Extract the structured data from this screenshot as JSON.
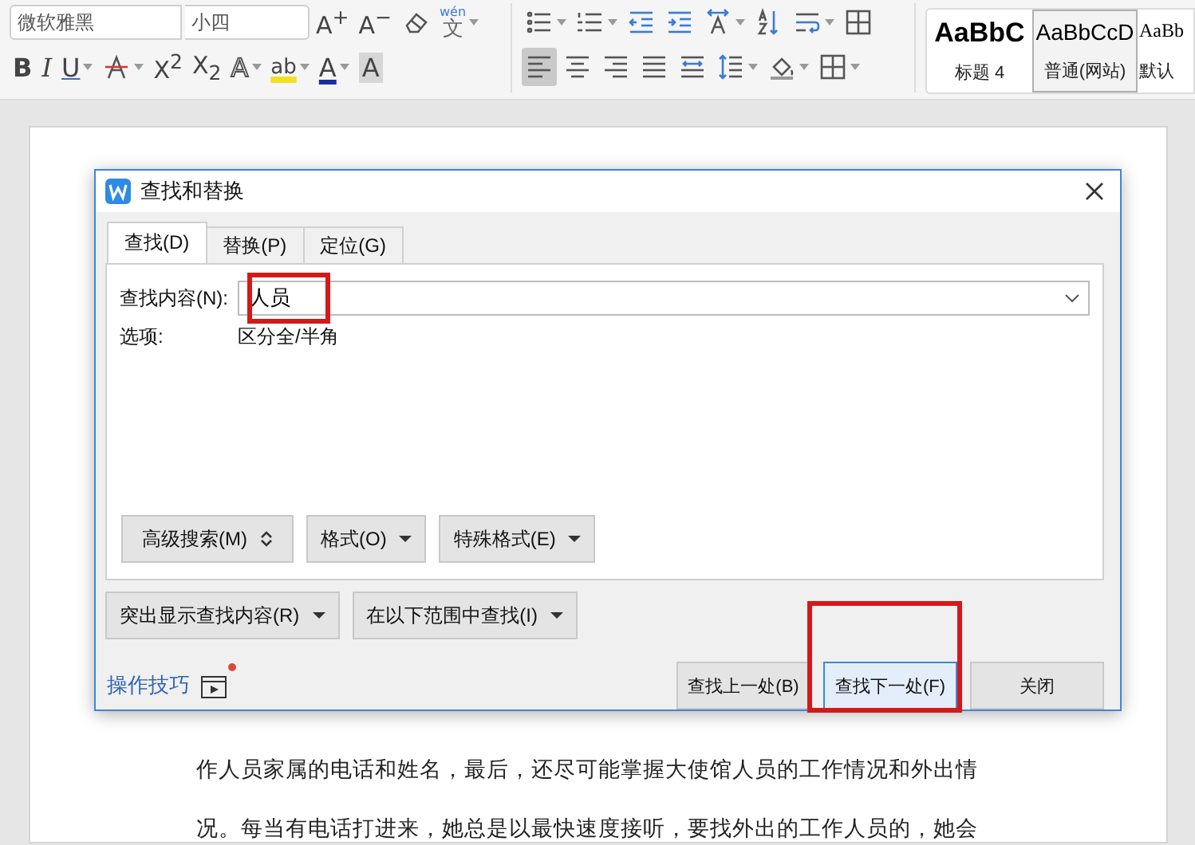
{
  "toolbar": {
    "font_field": {
      "value": "微软雅黑"
    },
    "size_field": {
      "value": "小四"
    },
    "font_row1": [
      {
        "kind": "plain",
        "text": "A$^{+}$",
        "dropdown": false
      },
      {
        "kind": "plain",
        "text": "A$^{−}$",
        "dropdown": false
      },
      {
        "kind": "eraser",
        "dropdown": false
      },
      {
        "kind": "ruby",
        "top": "wén",
        "text": "文",
        "dropdown": true
      }
    ],
    "font_row2": [
      {
        "kind": "bold",
        "text": "B",
        "dropdown": false
      },
      {
        "kind": "italic",
        "text": "I",
        "dropdown": false
      },
      {
        "kind": "underline",
        "text": "U",
        "dropdown": true
      },
      {
        "kind": "strikethrough",
        "dropdown": true
      },
      {
        "kind": "plain",
        "text": "X$^{2}$",
        "dropdown": false
      },
      {
        "kind": "plain",
        "text": "X$_{2}$",
        "dropdown": false
      },
      {
        "kind": "outline",
        "text": "A",
        "dropdown": true
      },
      {
        "kind": "highlight",
        "text": "ab",
        "dropdown": true
      },
      {
        "kind": "color",
        "text": "A",
        "dropdown": true
      },
      {
        "kind": "shaded",
        "text": "A",
        "dropdown": false
      }
    ],
    "para_row1": [
      {
        "kind": "bullets",
        "dropdown": true,
        "selected": false
      },
      {
        "kind": "numbers",
        "dropdown": true,
        "selected": false
      },
      {
        "kind": "outdent",
        "dropdown": false,
        "selected": false
      },
      {
        "kind": "indent",
        "dropdown": false,
        "selected": false
      },
      {
        "kind": "textdir",
        "dropdown": true,
        "selected": false
      },
      {
        "kind": "sort",
        "dropdown": false,
        "selected": false
      },
      {
        "kind": "wrap",
        "dropdown": true,
        "selected": false
      },
      {
        "kind": "table",
        "dropdown": false,
        "selected": false
      }
    ],
    "para_row2": [
      {
        "kind": "alignleft",
        "dropdown": false,
        "selected": true
      },
      {
        "kind": "aligncenter",
        "dropdown": false,
        "selected": false
      },
      {
        "kind": "alignright",
        "dropdown": false,
        "selected": false
      },
      {
        "kind": "justify",
        "dropdown": false,
        "selected": false
      },
      {
        "kind": "distribute",
        "dropdown": false,
        "selected": false
      },
      {
        "kind": "spacing",
        "dropdown": true,
        "selected": false
      },
      {
        "kind": "shading",
        "dropdown": true,
        "selected": false
      },
      {
        "kind": "borders",
        "dropdown": true,
        "selected": false
      }
    ],
    "styles": [
      {
        "kind": "heading",
        "preview": "AaBbC",
        "label": "标题 4",
        "selected": false
      },
      {
        "kind": "sans",
        "preview": "AaBbCcD",
        "label": "普通(网站)",
        "selected": true
      },
      {
        "kind": "serif",
        "preview": "AaBb",
        "label": "默认",
        "selected": false
      }
    ]
  },
  "document": {
    "lines": [
      "作人员家属的电话和姓名，最后，还尽可能掌握大使馆人员的工作情况和外出情",
      "况。每当有电话打进来，她总是以最快速度接听，要找外出的工作人员的，她会"
    ]
  },
  "dialog": {
    "title": "查找和替换",
    "tabs": [
      {
        "label": "查找(D)",
        "selected": true
      },
      {
        "label": "替换(P)",
        "selected": false
      },
      {
        "label": "定位(G)",
        "selected": false
      }
    ],
    "find": {
      "label": "查找内容(N):",
      "value": "人员",
      "highlighted": true
    },
    "options": {
      "label": "选项:",
      "value": "区分全/半角"
    },
    "panel_buttons": [
      {
        "label": "高级搜索(M)",
        "kind": "expand"
      },
      {
        "label": "格式(O)",
        "kind": "dropdown"
      },
      {
        "label": "特殊格式(E)",
        "kind": "dropdown"
      }
    ],
    "lower_buttons": [
      {
        "label": "突出显示查找内容(R)",
        "kind": "dropdown"
      },
      {
        "label": "在以下范围中查找(I)",
        "kind": "dropdown"
      }
    ],
    "tips": {
      "label": "操作技巧",
      "badge": true
    },
    "actions": [
      {
        "label": "查找上一处(B)",
        "focused": false,
        "highlighted": false
      },
      {
        "label": "查找下一处(F)",
        "focused": true,
        "highlighted": true
      },
      {
        "label": "关闭",
        "focused": false,
        "highlighted": false
      }
    ]
  }
}
